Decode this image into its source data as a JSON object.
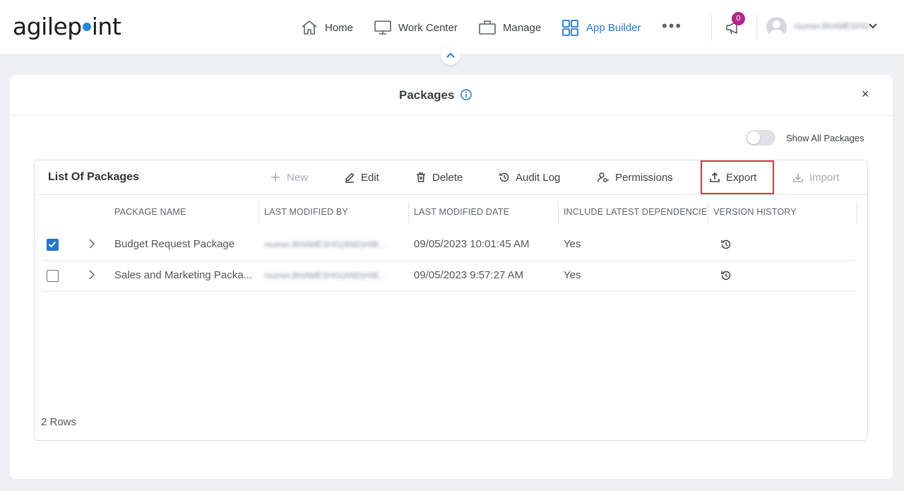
{
  "brand": {
    "logo_left": "agilep",
    "logo_right": "int"
  },
  "nav": {
    "items": [
      {
        "label": "Home",
        "icon": "home-icon"
      },
      {
        "label": "Work Center",
        "icon": "monitor-icon"
      },
      {
        "label": "Manage",
        "icon": "briefcase-icon"
      },
      {
        "label": "App Builder",
        "icon": "grid-icon",
        "active": true
      }
    ],
    "more": "•••",
    "notifications_count": "0",
    "username": "rsumer.BhAMESHG..."
  },
  "dialog": {
    "title": "Packages",
    "close": "×",
    "toggle_label": "Show All Packages",
    "toggle_on": false
  },
  "panel": {
    "title": "List Of Packages",
    "toolbar": {
      "new": "New",
      "edit": "Edit",
      "delete": "Delete",
      "audit_log": "Audit Log",
      "permissions": "Permissions",
      "export": "Export",
      "import": "Import"
    },
    "columns": [
      "PACKAGE NAME",
      "LAST MODIFIED BY",
      "LAST MODIFIED DATE",
      "INCLUDE LATEST DEPENDENCIES",
      "VERSION HISTORY"
    ],
    "rows": [
      {
        "checked": true,
        "name": "Budget Request Package",
        "modified_by": "rsumer.BHAMESHG(AND)HIB...",
        "modified_date": "09/05/2023 10:01:45 AM",
        "dependencies": "Yes"
      },
      {
        "checked": false,
        "name": "Sales and Marketing Packa...",
        "modified_by": "rsumer.BHAMESHG(AND)HIB...",
        "modified_date": "09/05/2023 9:57:27 AM",
        "dependencies": "Yes"
      }
    ],
    "row_count": "2 Rows"
  },
  "colors": {
    "accent": "#1f78d1",
    "badge": "#b3248c",
    "highlight": "#d9383a"
  }
}
